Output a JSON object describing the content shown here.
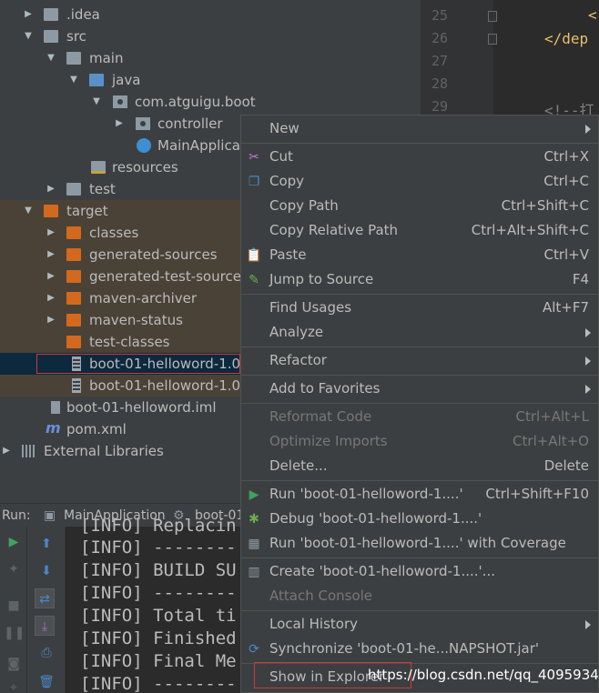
{
  "tree": {
    "items": [
      {
        "label": ".idea"
      },
      {
        "label": "src"
      },
      {
        "label": "main"
      },
      {
        "label": "java"
      },
      {
        "label": "com.atguigu.boot"
      },
      {
        "label": "controller"
      },
      {
        "label": "MainApplica"
      },
      {
        "label": "resources"
      },
      {
        "label": "test"
      },
      {
        "label": "target"
      },
      {
        "label": "classes"
      },
      {
        "label": "generated-sources"
      },
      {
        "label": "generated-test-sources"
      },
      {
        "label": "maven-archiver"
      },
      {
        "label": "maven-status"
      },
      {
        "label": "test-classes"
      },
      {
        "label": "boot-01-helloword-1.0"
      },
      {
        "label": "boot-01-helloword-1.0"
      },
      {
        "label": "boot-01-helloword.iml"
      },
      {
        "label": "pom.xml"
      },
      {
        "label": "External Libraries"
      }
    ]
  },
  "editor": {
    "line_numbers": [
      "25",
      "26",
      "27",
      "28",
      "29"
    ],
    "lines": [
      "<",
      "</dep",
      "",
      "",
      "<!--打"
    ]
  },
  "run": {
    "label": "Run:",
    "tabs": [
      "MainApplication",
      "boot-01"
    ],
    "console": [
      "[INFO] Replacin",
      "[INFO] --------",
      "[INFO] BUILD SU",
      "[INFO] --------",
      "[INFO] Total ti",
      "[INFO] Finished",
      "[INFO] Final Me",
      "[INFO] --------"
    ]
  },
  "menu": {
    "items": [
      {
        "label": "New",
        "shortcut": ""
      },
      {
        "label": "Cut",
        "shortcut": "Ctrl+X"
      },
      {
        "label": "Copy",
        "shortcut": "Ctrl+C"
      },
      {
        "label": "Copy Path",
        "shortcut": "Ctrl+Shift+C"
      },
      {
        "label": "Copy Relative Path",
        "shortcut": "Ctrl+Alt+Shift+C"
      },
      {
        "label": "Paste",
        "shortcut": "Ctrl+V"
      },
      {
        "label": "Jump to Source",
        "shortcut": "F4"
      },
      {
        "label": "Find Usages",
        "shortcut": "Alt+F7"
      },
      {
        "label": "Analyze",
        "shortcut": ""
      },
      {
        "label": "Refactor",
        "shortcut": ""
      },
      {
        "label": "Add to Favorites",
        "shortcut": ""
      },
      {
        "label": "Reformat Code",
        "shortcut": "Ctrl+Alt+L"
      },
      {
        "label": "Optimize Imports",
        "shortcut": "Ctrl+Alt+O"
      },
      {
        "label": "Delete...",
        "shortcut": "Delete"
      },
      {
        "label": "Run 'boot-01-helloword-1....'",
        "shortcut": "Ctrl+Shift+F10"
      },
      {
        "label": "Debug 'boot-01-helloword-1....'",
        "shortcut": ""
      },
      {
        "label": "Run 'boot-01-helloword-1....' with Coverage",
        "shortcut": ""
      },
      {
        "label": "Create 'boot-01-helloword-1....'...",
        "shortcut": ""
      },
      {
        "label": "Attach Console",
        "shortcut": ""
      },
      {
        "label": "Local History",
        "shortcut": ""
      },
      {
        "label": "Synchronize 'boot-01-he...NAPSHOT.jar'",
        "shortcut": ""
      },
      {
        "label": "Show in Explorer",
        "shortcut": ""
      }
    ]
  },
  "watermark": "https://blog.csdn.net/qq_40959340",
  "colors": {
    "panel_bg": "#3c3f41",
    "editor_bg": "#2b2b2b",
    "selection": "#0d293e",
    "target_highlight": "#4a4237",
    "annotation_red": "#c93b3b",
    "xml_tag": "#e8bf6a"
  },
  "icons": {
    "folder": "folder-icon",
    "package": "package-icon",
    "jar": "jar-icon",
    "maven": "maven-icon",
    "run": "run-icon",
    "debug": "debug-icon",
    "cut": "scissors-icon",
    "copy": "copy-icon",
    "paste": "paste-icon"
  }
}
